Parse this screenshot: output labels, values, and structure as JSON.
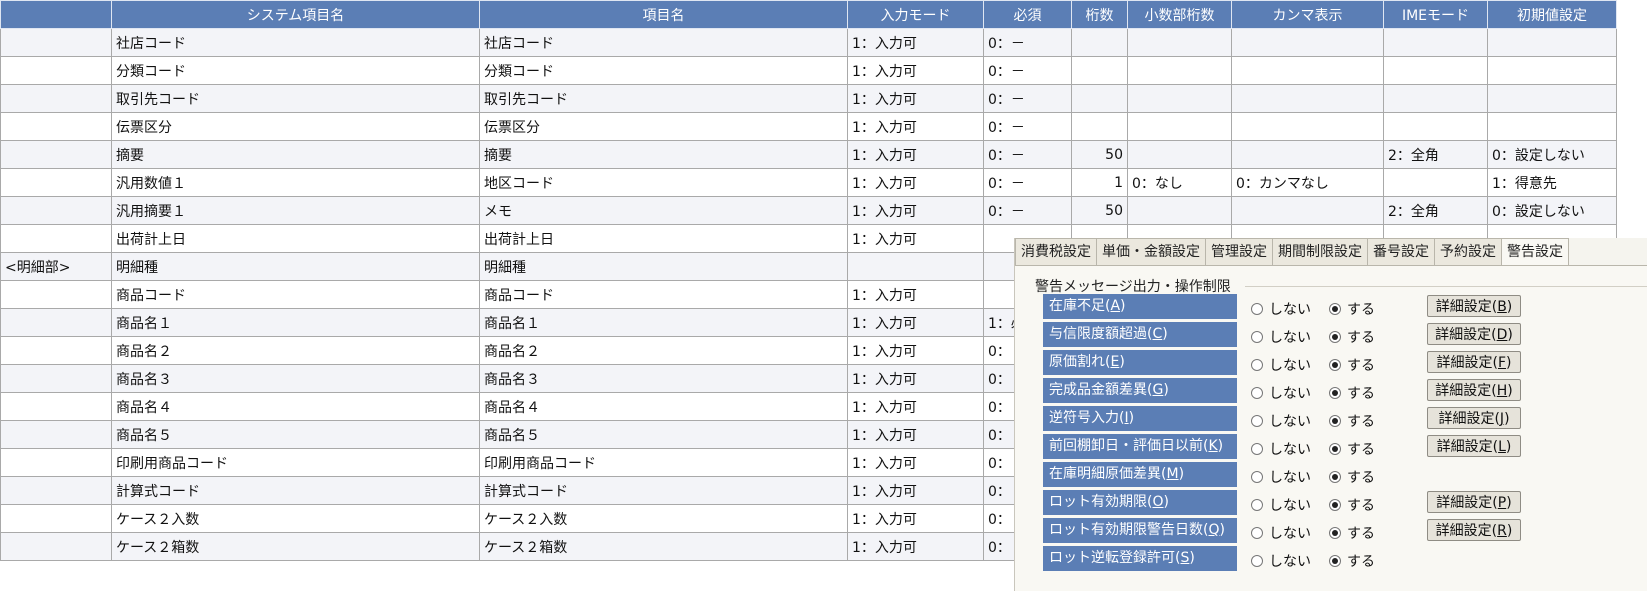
{
  "grid": {
    "headers": [
      "",
      "システム項目名",
      "項目名",
      "入力モード",
      "必須",
      "桁数",
      "小数部桁数",
      "カンマ表示",
      "IMEモード",
      "初期値設定"
    ],
    "rows": [
      [
        "",
        "社店コード",
        "社店コード",
        "1：入力可",
        "0：－",
        "",
        "",
        "",
        "",
        ""
      ],
      [
        "",
        "分類コード",
        "分類コード",
        "1：入力可",
        "0：－",
        "",
        "",
        "",
        "",
        ""
      ],
      [
        "",
        "取引先コード",
        "取引先コード",
        "1：入力可",
        "0：－",
        "",
        "",
        "",
        "",
        ""
      ],
      [
        "",
        "伝票区分",
        "伝票区分",
        "1：入力可",
        "0：－",
        "",
        "",
        "",
        "",
        ""
      ],
      [
        "",
        "摘要",
        "摘要",
        "1：入力可",
        "0：－",
        "50",
        "",
        "",
        "2：全角",
        "0：設定しない"
      ],
      [
        "",
        "汎用数値１",
        "地区コード",
        "1：入力可",
        "0：－",
        "1",
        "0：なし",
        "0：カンマなし",
        "",
        "1：得意先"
      ],
      [
        "",
        "汎用摘要１",
        "メモ",
        "1：入力可",
        "0：－",
        "50",
        "",
        "",
        "2：全角",
        "0：設定しない"
      ],
      [
        "",
        "出荷計上日",
        "出荷計上日",
        "1：入力可",
        "",
        "",
        "",
        "",
        "",
        ""
      ],
      [
        "<明細部>",
        "明細種",
        "明細種",
        "",
        "",
        "",
        "",
        "",
        "",
        ""
      ],
      [
        "",
        "商品コード",
        "商品コード",
        "1：入力可",
        "",
        "",
        "",
        "",
        "",
        ""
      ],
      [
        "",
        "商品名１",
        "商品名１",
        "1：入力可",
        "1：必",
        "",
        "",
        "",
        "",
        ""
      ],
      [
        "",
        "商品名２",
        "商品名２",
        "1：入力可",
        "0：",
        "",
        "",
        "",
        "",
        ""
      ],
      [
        "",
        "商品名３",
        "商品名３",
        "1：入力可",
        "0：",
        "",
        "",
        "",
        "",
        ""
      ],
      [
        "",
        "商品名４",
        "商品名４",
        "1：入力可",
        "0：",
        "",
        "",
        "",
        "",
        ""
      ],
      [
        "",
        "商品名５",
        "商品名５",
        "1：入力可",
        "0：",
        "",
        "",
        "",
        "",
        ""
      ],
      [
        "",
        "印刷用商品コード",
        "印刷用商品コード",
        "1：入力可",
        "0：",
        "",
        "",
        "",
        "",
        ""
      ],
      [
        "",
        "計算式コード",
        "計算式コード",
        "1：入力可",
        "0：",
        "",
        "",
        "",
        "",
        ""
      ],
      [
        "",
        "ケース２入数",
        "ケース２入数",
        "1：入力可",
        "0：",
        "",
        "",
        "",
        "",
        ""
      ],
      [
        "",
        "ケース２箱数",
        "ケース２箱数",
        "1：入力可",
        "0：",
        "",
        "",
        "",
        "",
        ""
      ]
    ]
  },
  "panel": {
    "tabs": [
      {
        "label": "消費税設定",
        "active": false
      },
      {
        "label": "単価・金額設定",
        "active": false
      },
      {
        "label": "管理設定",
        "active": false
      },
      {
        "label": "期間制限設定",
        "active": false
      },
      {
        "label": "番号設定",
        "active": false
      },
      {
        "label": "予約設定",
        "active": false
      },
      {
        "label": "警告設定",
        "active": true
      }
    ],
    "section_title": "警告メッセージ出力・操作制限",
    "option_off": "しない",
    "option_on": "する",
    "detail_label": "詳細設定",
    "rows": [
      {
        "label": "在庫不足",
        "key": "A",
        "selected": "on",
        "detail_key": "B"
      },
      {
        "label": "与信限度額超過",
        "key": "C",
        "selected": "on",
        "detail_key": "D"
      },
      {
        "label": "原価割れ",
        "key": "E",
        "selected": "on",
        "detail_key": "F"
      },
      {
        "label": "完成品金額差異",
        "key": "G",
        "selected": "on",
        "detail_key": "H"
      },
      {
        "label": "逆符号入力",
        "key": "I",
        "selected": "on",
        "detail_key": "J"
      },
      {
        "label": "前回棚卸日・評価日以前",
        "key": "K",
        "selected": "on",
        "detail_key": "L"
      },
      {
        "label": "在庫明細原価差異",
        "key": "M",
        "selected": "on",
        "detail_key": ""
      },
      {
        "label": "ロット有効期限",
        "key": "O",
        "selected": "on",
        "detail_key": "P"
      },
      {
        "label": "ロット有効期限警告日数",
        "key": "Q",
        "selected": "on",
        "detail_key": "R"
      },
      {
        "label": "ロット逆転登録許可",
        "key": "S",
        "selected": "on",
        "detail_key": ""
      }
    ]
  }
}
